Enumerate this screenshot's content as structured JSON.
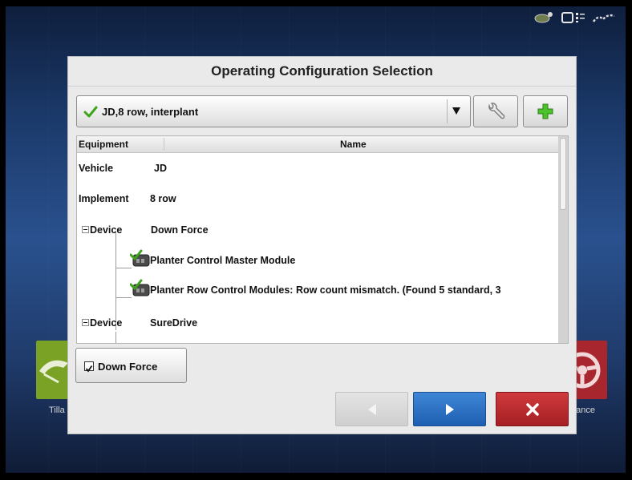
{
  "dialog": {
    "title": "Operating Configuration Selection"
  },
  "config_select": {
    "value": "JD,8 row, interplant",
    "icon": "check-icon"
  },
  "toolbar": {
    "wrench_icon": "wrench-icon",
    "add_icon": "plus-icon"
  },
  "tree": {
    "headers": {
      "equipment": "Equipment",
      "name": "Name"
    },
    "rows": [
      {
        "type": "Vehicle",
        "name": "JD"
      },
      {
        "type": "Implement",
        "name": "8 row"
      },
      {
        "type": "Device",
        "name": "Down Force"
      },
      {
        "type": "",
        "name": "Planter Control Master Module"
      },
      {
        "type": "",
        "name": "Planter Row Control Modules: Row count mismatch. (Found 5 standard, 3"
      },
      {
        "type": "Device",
        "name": "SureDrive"
      }
    ]
  },
  "down_force_toggle": {
    "label": "Down Force",
    "checked": true
  },
  "background": {
    "left_tile_label": "Tilla",
    "right_tile_label": "dance"
  },
  "colors": {
    "next_button": "#2a6fc4",
    "cancel_button": "#b8292d",
    "accent_green": "#3ca51c"
  }
}
